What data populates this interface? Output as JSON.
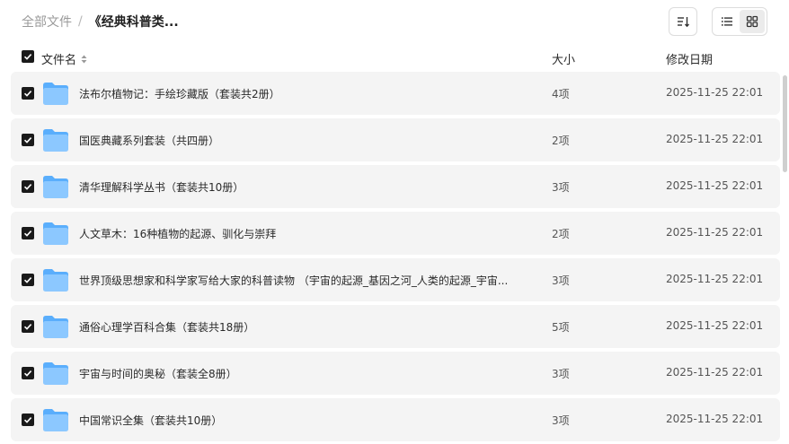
{
  "breadcrumb": {
    "root": "全部文件",
    "separator": "/",
    "current": "《经典科普类..."
  },
  "columns": {
    "name": "文件名",
    "size": "大小",
    "modified": "修改日期"
  },
  "files": [
    {
      "name": "法布尔植物记：手绘珍藏版（套装共2册）",
      "size": "4项",
      "modified": "2025-11-25 22:01"
    },
    {
      "name": "国医典藏系列套装（共四册）",
      "size": "2项",
      "modified": "2025-11-25 22:01"
    },
    {
      "name": "清华理解科学丛书（套装共10册）",
      "size": "3项",
      "modified": "2025-11-25 22:01"
    },
    {
      "name": "人文草木：16种植物的起源、驯化与崇拜",
      "size": "2项",
      "modified": "2025-11-25 22:01"
    },
    {
      "name": "世界顶级思想家和科学家写给大家的科普读物 （宇宙的起源_基因之河_人类的起源_宇宙...",
      "size": "3项",
      "modified": "2025-11-25 22:01"
    },
    {
      "name": "通俗心理学百科合集（套装共18册）",
      "size": "5项",
      "modified": "2025-11-25 22:01"
    },
    {
      "name": "宇宙与时间的奥秘（套装全8册）",
      "size": "3项",
      "modified": "2025-11-25 22:01"
    },
    {
      "name": "中国常识全集（套装共10册）",
      "size": "3项",
      "modified": "2025-11-25 22:01"
    }
  ],
  "icons": {
    "sort": "sort-descending-icon",
    "list_view": "list-view-icon",
    "grid_view": "grid-view-icon",
    "folder": "folder-icon",
    "checkbox": "checkbox-checked-icon"
  },
  "colors": {
    "folder_front": "#8cc8ff",
    "folder_back": "#5aaefc",
    "row_background": "#f4f4f4",
    "checkbox": "#1a1a1a"
  }
}
